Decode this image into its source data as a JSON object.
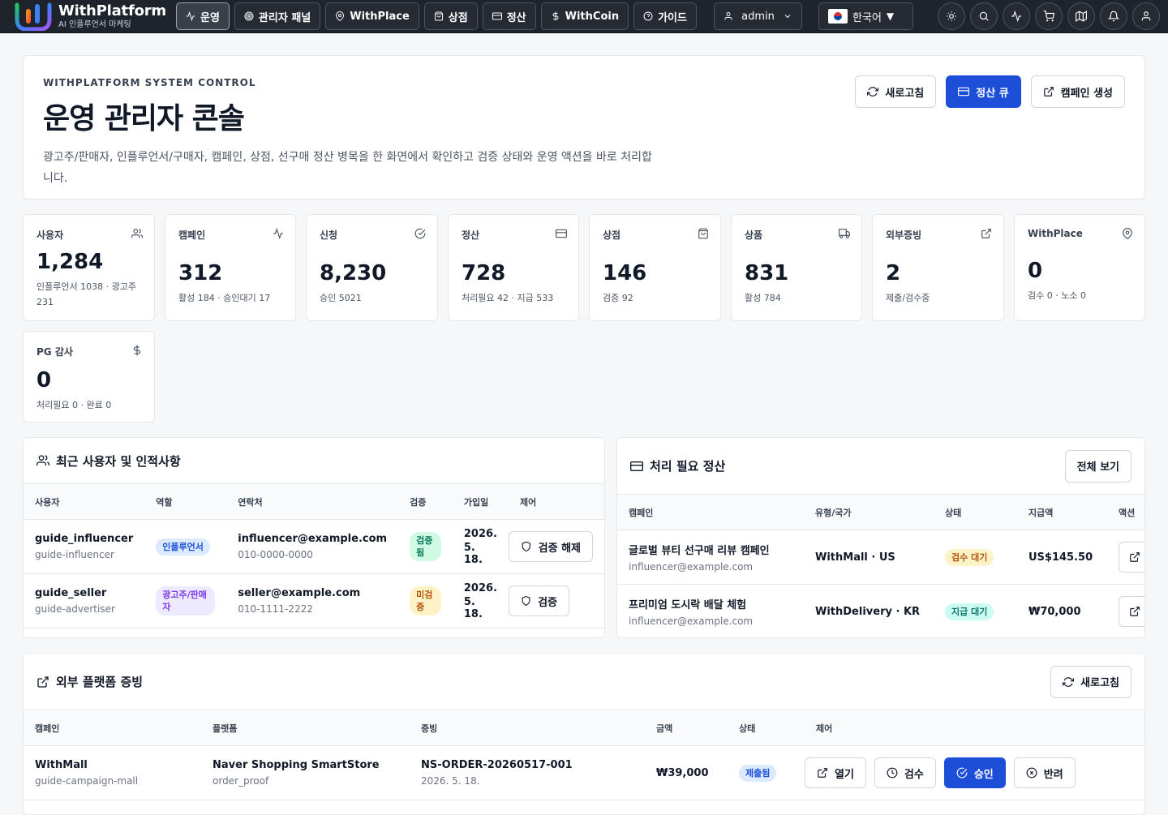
{
  "brand": {
    "name": "WithPlatform",
    "tagline": "AI 인플루언서 마케팅"
  },
  "nav": [
    {
      "label": "운영",
      "icon": "activity-icon",
      "active": true
    },
    {
      "label": "관리자 패널",
      "icon": "target-icon"
    },
    {
      "label": "WithPlace",
      "icon": "map-pin-icon"
    },
    {
      "label": "상점",
      "icon": "shopping-bag-icon"
    },
    {
      "label": "정산",
      "icon": "credit-card-icon"
    },
    {
      "label": "WithCoin",
      "icon": "dollar-icon"
    },
    {
      "label": "가이드",
      "icon": "help-circle-icon"
    }
  ],
  "user_menu": {
    "label": "admin"
  },
  "language": {
    "label": "한국어"
  },
  "toolbar_icons": [
    "sun-icon",
    "search-icon",
    "activity-icon",
    "cart-icon",
    "map-icon",
    "bell-icon",
    "user-icon"
  ],
  "hero": {
    "eyebrow": "WITHPLATFORM SYSTEM CONTROL",
    "title": "운영 관리자 콘솔",
    "description": "광고주/판매자, 인플루언서/구매자, 캠페인, 상점, 선구매 정산 병목을 한 화면에서 확인하고 검증 상태와 운영 액션을 바로 처리합니다.",
    "refresh_label": "새로고침",
    "settlement_queue_label": "정산 큐",
    "create_campaign_label": "캠페인 생성"
  },
  "stats": [
    {
      "label": "사용자",
      "value": "1,284",
      "sub": "인플루언서 1038 · 광고주 231",
      "icon": "users-icon"
    },
    {
      "label": "캠페인",
      "value": "312",
      "sub": "활성 184 · 승인대기 17",
      "icon": "activity-icon"
    },
    {
      "label": "신청",
      "value": "8,230",
      "sub": "승인 5021",
      "icon": "check-circle-icon"
    },
    {
      "label": "정산",
      "value": "728",
      "sub": "처리필요 42 · 지급 533",
      "icon": "credit-card-icon"
    },
    {
      "label": "상점",
      "value": "146",
      "sub": "검증 92",
      "icon": "shopping-bag-icon"
    },
    {
      "label": "상품",
      "value": "831",
      "sub": "활성 784",
      "icon": "truck-icon"
    },
    {
      "label": "외부증빙",
      "value": "2",
      "sub": "제출/검수중",
      "icon": "external-link-icon"
    },
    {
      "label": "WithPlace",
      "value": "0",
      "sub": "검수 0 · 노소 0",
      "icon": "map-pin-icon"
    },
    {
      "label": "PG 감사",
      "value": "0",
      "sub": "처리필요 0 · 완료 0",
      "icon": "dollar-icon"
    }
  ],
  "users_card": {
    "title": "최근 사용자 및 인적사항",
    "columns": [
      "사용자",
      "역할",
      "연락처",
      "검증",
      "가입일",
      "제어"
    ],
    "rows": [
      {
        "name": "guide_influencer",
        "handle": "guide-influencer",
        "role": "인플루언서",
        "email": "influencer@example.com",
        "phone": "010-0000-0000",
        "status": "검증됨",
        "date_line1": "2026.",
        "date_line2": "5. 18.",
        "action": "검증 해제"
      },
      {
        "name": "guide_seller",
        "handle": "guide-advertiser",
        "role": "광고주/판매자",
        "email": "seller@example.com",
        "phone": "010-1111-2222",
        "status": "미검증",
        "date_line1": "2026.",
        "date_line2": "5. 18.",
        "action": "검증"
      }
    ]
  },
  "settlement_card": {
    "title": "처리 필요 정산",
    "view_all_label": "전체 보기",
    "columns": [
      "캠페인",
      "유형/국가",
      "상태",
      "지급액",
      "액션"
    ],
    "rows": [
      {
        "campaign": "글로벌 뷰티 선구매 리뷰 캠페인",
        "email": "influencer@example.com",
        "type": "WithMall · US",
        "status": "검수 대기",
        "amount": "US$145.50"
      },
      {
        "campaign": "프리미엄 도시락 배달 체험",
        "email": "influencer@example.com",
        "type": "WithDelivery · KR",
        "status": "지급 대기",
        "amount": "₩70,000"
      }
    ]
  },
  "proof_card": {
    "title": "외부 플랫폼 증빙",
    "refresh_label": "새로고침",
    "columns": [
      "캠페인",
      "플랫폼",
      "증빙",
      "금액",
      "상태",
      "제어"
    ],
    "rows": [
      {
        "campaign": "WithMall",
        "campaign_id": "guide-campaign-mall",
        "platform": "Naver Shopping SmartStore",
        "proof_type": "order_proof",
        "proof_id": "NS-ORDER-20260517-001",
        "proof_date": "2026. 5. 18.",
        "amount": "₩39,000",
        "status": "제출됨",
        "open_label": "열기",
        "review_label": "검수",
        "approve_label": "승인",
        "reject_label": "반려"
      }
    ]
  }
}
